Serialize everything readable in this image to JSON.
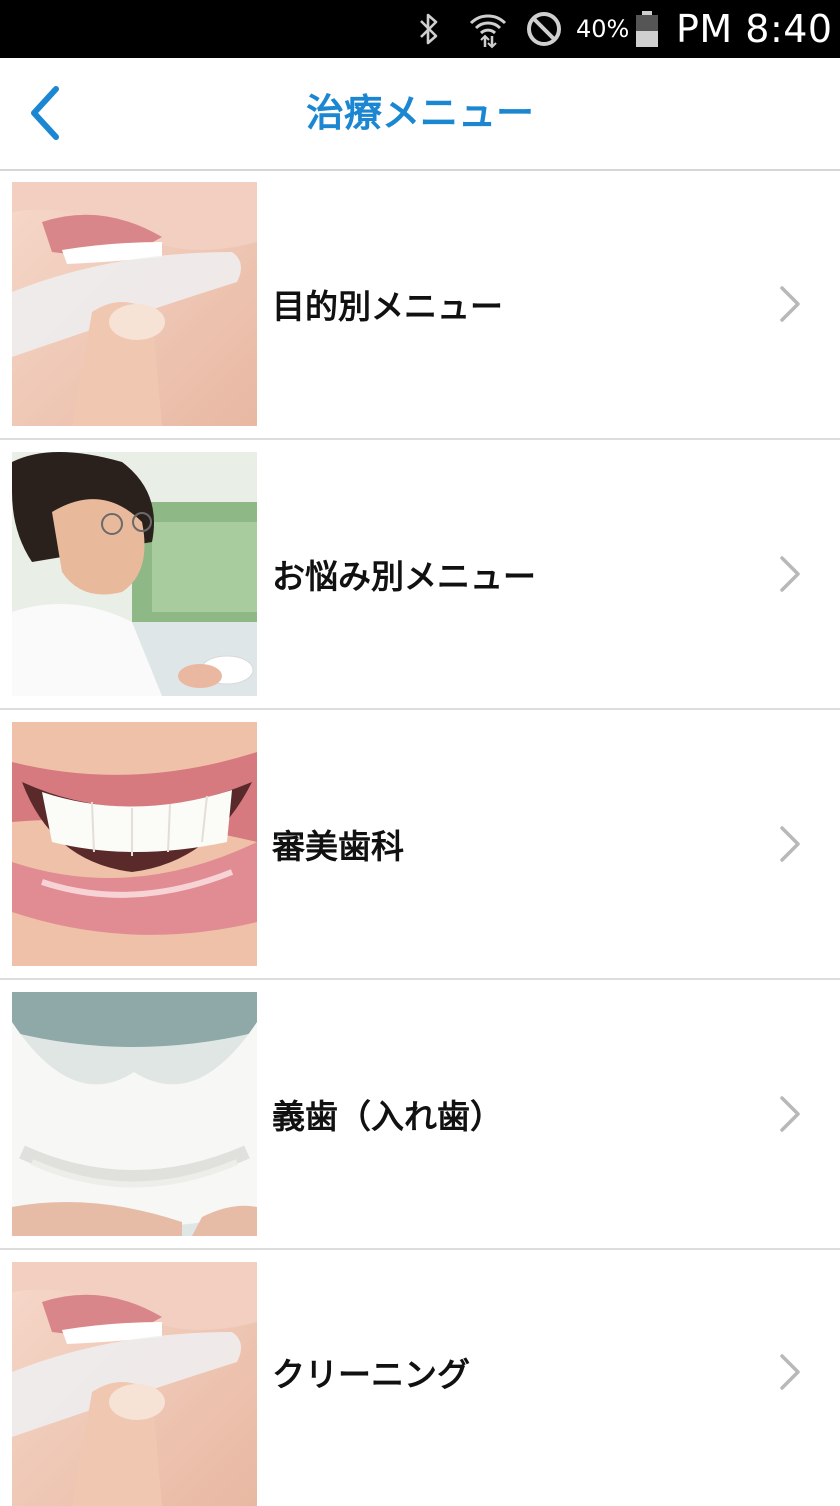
{
  "status_bar": {
    "battery_percent": "40%",
    "time": "PM 8:40",
    "icons": [
      "bluetooth-icon",
      "wifi-icon",
      "do-not-disturb-icon",
      "battery-icon"
    ]
  },
  "header": {
    "title": "治療メニュー",
    "back_icon": "chevron-left-icon",
    "accent_color": "#1b86d1"
  },
  "menu": {
    "items": [
      {
        "label": "目的別メニュー",
        "thumbnail": "mouthpiece-photo"
      },
      {
        "label": "お悩み別メニュー",
        "thumbnail": "smiling-woman-photo"
      },
      {
        "label": "審美歯科",
        "thumbnail": "smile-teeth-photo"
      },
      {
        "label": "義歯（入れ歯）",
        "thumbnail": "dental-model-photo"
      },
      {
        "label": "クリーニング",
        "thumbnail": "mouthpiece-photo"
      }
    ],
    "chevron_icon": "chevron-right-icon"
  }
}
